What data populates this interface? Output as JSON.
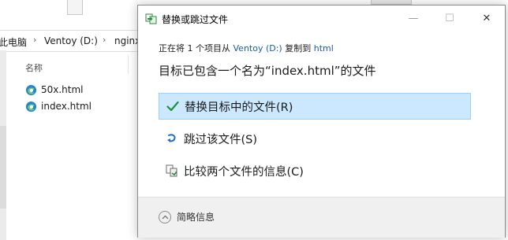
{
  "explorer": {
    "breadcrumbs": [
      "此电脑",
      "Ventoy (D:)",
      "nginx"
    ],
    "column_header": "名称",
    "files": [
      {
        "name": "50x.html",
        "icon": "edge-icon"
      },
      {
        "name": "index.html",
        "icon": "edge-icon"
      }
    ]
  },
  "dialog": {
    "title": "替换或跳过文件",
    "status": {
      "prefix": "正在将 1 个项目从 ",
      "source": "Ventoy (D:)",
      "middle": " 复制到 ",
      "destination": "html"
    },
    "message": "目标已包含一个名为“index.html”的文件",
    "options": [
      {
        "label": "替换目标中的文件(R)",
        "icon": "checkmark-icon",
        "selected": true
      },
      {
        "label": "跳过该文件(S)",
        "icon": "skip-arrow-icon",
        "selected": false
      },
      {
        "label": "比较两个文件的信息(C)",
        "icon": "compare-files-icon",
        "selected": false
      }
    ],
    "details_label": "简略信息",
    "window_buttons": {
      "minimize": "—",
      "maximize": "☐",
      "close": "✕"
    }
  },
  "colors": {
    "accent_link": "#1a5ea8",
    "selected_bg": "#cce8ff",
    "selected_border": "#99d1ff",
    "check_green": "#1e8f3e"
  }
}
